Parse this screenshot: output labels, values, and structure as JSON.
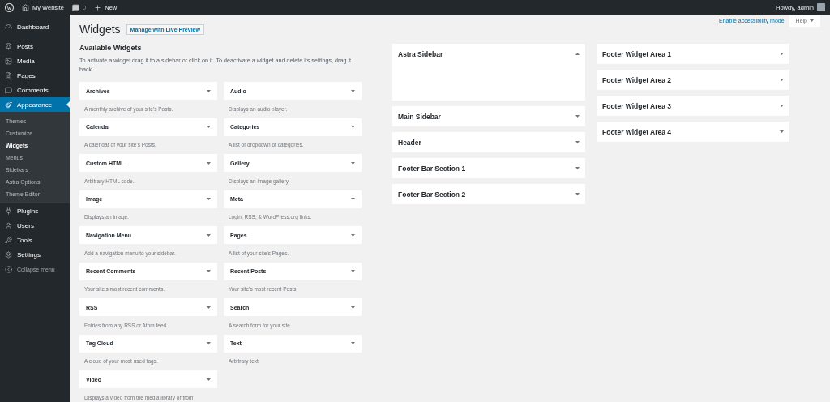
{
  "admin_bar": {
    "site_name": "My Website",
    "comments_count": "0",
    "new_label": "New",
    "greeting": "Howdy, admin"
  },
  "sidebar": {
    "items": [
      {
        "label": "Dashboard",
        "selected": false
      },
      {
        "label": "Posts",
        "selected": false
      },
      {
        "label": "Media",
        "selected": false
      },
      {
        "label": "Pages",
        "selected": false
      },
      {
        "label": "Comments",
        "selected": false
      },
      {
        "label": "Appearance",
        "selected": true,
        "children": [
          {
            "label": "Themes",
            "selected": false
          },
          {
            "label": "Customize",
            "selected": false
          },
          {
            "label": "Widgets",
            "selected": true
          },
          {
            "label": "Menus",
            "selected": false
          },
          {
            "label": "Sidebars",
            "selected": false
          },
          {
            "label": "Astra Options",
            "selected": false
          },
          {
            "label": "Theme Editor",
            "selected": false
          }
        ]
      },
      {
        "label": "Plugins",
        "selected": false
      },
      {
        "label": "Users",
        "selected": false
      },
      {
        "label": "Tools",
        "selected": false
      },
      {
        "label": "Settings",
        "selected": false
      }
    ],
    "collapse_label": "Collapse menu"
  },
  "screen_options": {
    "accessibility_link": "Enable accessibility mode",
    "help": "Help"
  },
  "header": {
    "title": "Widgets",
    "action": "Manage with Live Preview"
  },
  "available_widgets": {
    "title": "Available Widgets",
    "instructions": "To activate a widget drag it to a sidebar or click on it. To deactivate a widget and delete its settings, drag it back.",
    "items": [
      {
        "title": "Archives",
        "description": "A monthly archive of your site’s Posts."
      },
      {
        "title": "Audio",
        "description": "Displays an audio player."
      },
      {
        "title": "Calendar",
        "description": "A calendar of your site’s Posts."
      },
      {
        "title": "Categories",
        "description": "A list or dropdown of categories."
      },
      {
        "title": "Custom HTML",
        "description": "Arbitrary HTML code."
      },
      {
        "title": "Gallery",
        "description": "Displays an image gallery."
      },
      {
        "title": "Image",
        "description": "Displays an image."
      },
      {
        "title": "Meta",
        "description": "Login, RSS, & WordPress.org links."
      },
      {
        "title": "Navigation Menu",
        "description": "Add a navigation menu to your sidebar."
      },
      {
        "title": "Pages",
        "description": "A list of your site’s Pages."
      },
      {
        "title": "Recent Comments",
        "description": "Your site’s most recent comments."
      },
      {
        "title": "Recent Posts",
        "description": "Your site’s most recent Posts."
      },
      {
        "title": "RSS",
        "description": "Entries from any RSS or Atom feed."
      },
      {
        "title": "Search",
        "description": "A search form for your site."
      },
      {
        "title": "Tag Cloud",
        "description": "A cloud of your most used tags."
      },
      {
        "title": "Text",
        "description": "Arbitrary text."
      },
      {
        "title": "Video",
        "description": "Displays a video from the media library or from"
      }
    ]
  },
  "widget_areas": [
    [
      {
        "title": "Astra Sidebar",
        "expanded": true
      },
      {
        "title": "Main Sidebar",
        "expanded": false
      },
      {
        "title": "Header",
        "expanded": false
      },
      {
        "title": "Footer Bar Section 1",
        "expanded": false
      },
      {
        "title": "Footer Bar Section 2",
        "expanded": false
      }
    ],
    [
      {
        "title": "Footer Widget Area 1",
        "expanded": false
      },
      {
        "title": "Footer Widget Area 2",
        "expanded": false
      },
      {
        "title": "Footer Widget Area 3",
        "expanded": false
      },
      {
        "title": "Footer Widget Area 4",
        "expanded": false
      }
    ]
  ]
}
